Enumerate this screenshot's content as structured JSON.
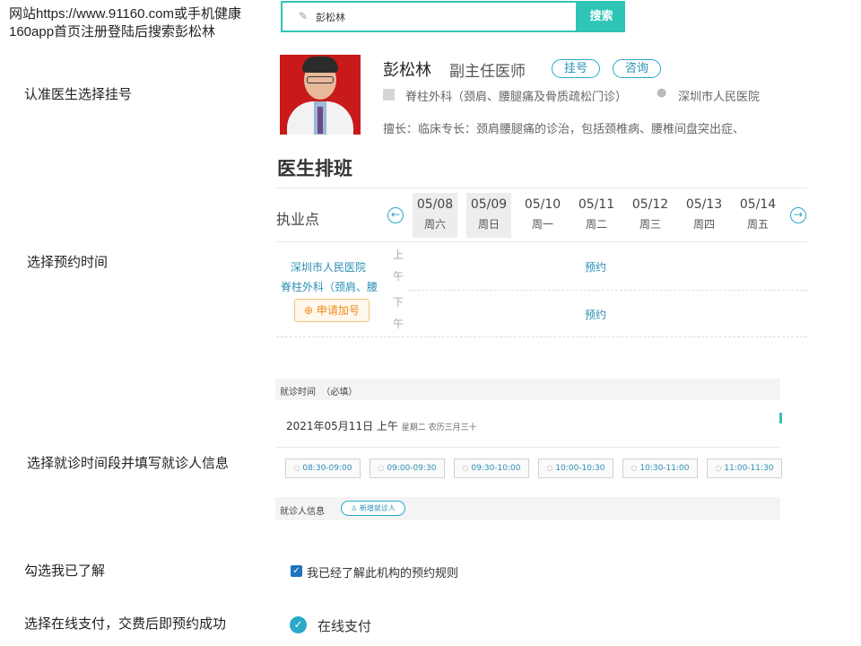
{
  "notes": {
    "search_hint": "网站https://www.91160.com或手机健康160app首页注册登陆后搜索彭松林",
    "choose_doctor": "认准医生选择挂号",
    "choose_time": "选择预约时间",
    "choose_slot": "选择就诊时间段并填写就诊人信息",
    "check_rules": "勾选我已了解",
    "pay_online": "选择在线支付，交费后即预约成功"
  },
  "search": {
    "value": "彭松林",
    "button_label": "搜索",
    "icon": "pencil-icon"
  },
  "doctor": {
    "name": "彭松林",
    "title": "副主任医师",
    "register_label": "挂号",
    "consult_label": "咨询",
    "department": "脊柱外科（颈肩、腰腿痛及骨质疏松门诊）",
    "hospital": "深圳市人民医院",
    "skill": "擅长：临床专长：颈肩腰腿痛的诊治，包括颈椎病、腰椎间盘突出症、"
  },
  "schedule": {
    "title": "医生排班",
    "column_header": "执业点",
    "days": [
      {
        "date": "05/08",
        "weekday": "周六",
        "highlighted": true
      },
      {
        "date": "05/09",
        "weekday": "周日",
        "highlighted": true
      },
      {
        "date": "05/10",
        "weekday": "周一",
        "highlighted": false
      },
      {
        "date": "05/11",
        "weekday": "周二",
        "highlighted": false
      },
      {
        "date": "05/12",
        "weekday": "周三",
        "highlighted": false
      },
      {
        "date": "05/13",
        "weekday": "周四",
        "highlighted": false
      },
      {
        "date": "05/14",
        "weekday": "周五",
        "highlighted": false
      }
    ],
    "site_hospital": "深圳市人民医院",
    "site_department": "脊柱外科（颈肩、腰",
    "apply_extra_label": "申请加号",
    "morning": "上午",
    "afternoon": "下午",
    "morning_slot": "预约",
    "afternoon_slot": "预约"
  },
  "visit": {
    "time_label": "就诊时间",
    "required_label": "（必填）",
    "date": "2021年05月11日 上午",
    "date_extra": "星期二 农历三月三十",
    "slots": [
      "08:30-09:00",
      "09:00-09:30",
      "09:30-10:00",
      "10:00-10:30",
      "10:30-11:00",
      "11:00-11:30"
    ],
    "patient_label": "就诊人信息",
    "add_patient_label": "新增就诊人"
  },
  "agree": {
    "label": "我已经了解此机构的预约规则",
    "checked": true
  },
  "payment": {
    "label": "在线支付"
  },
  "colors": {
    "accent": "#2ec4b6",
    "link": "#2a8fb5",
    "checkbox": "#1e73be",
    "apply": "#f08a1c"
  }
}
